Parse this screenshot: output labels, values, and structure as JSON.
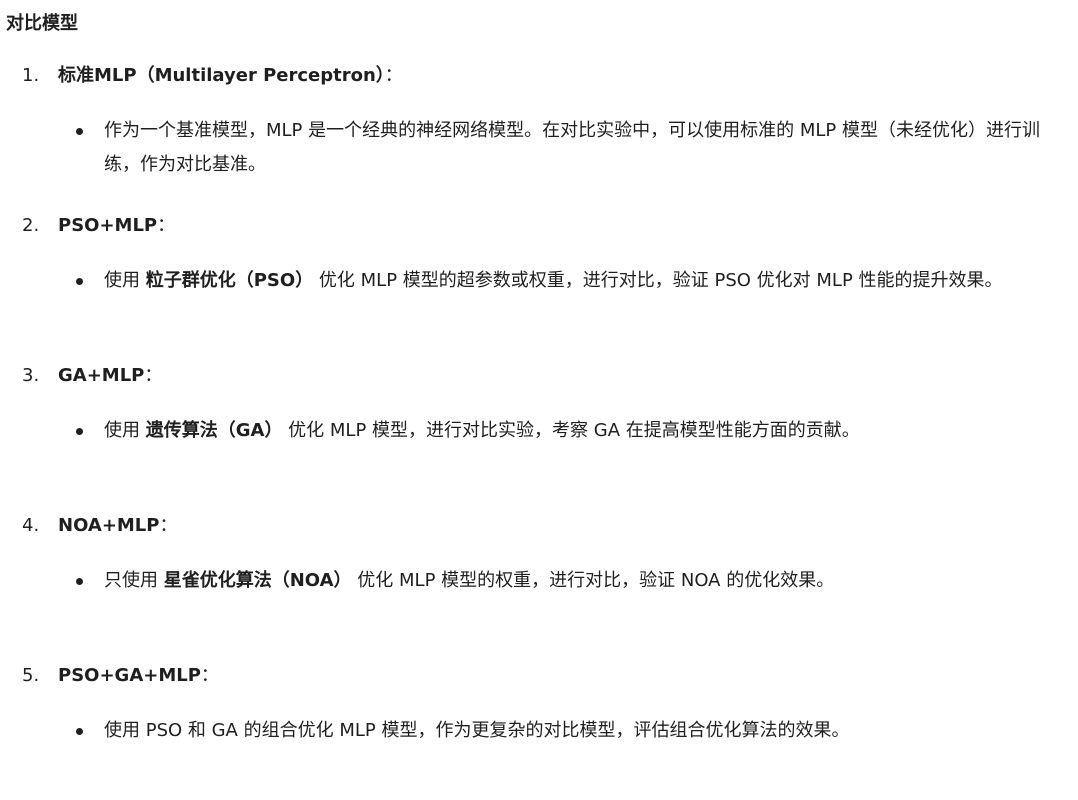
{
  "heading": "对比模型",
  "items": [
    {
      "number": "1.",
      "title": "标准MLP（Multilayer Perceptron）",
      "colon": "：",
      "bullet": {
        "pre": "作为一个基准模型，MLP 是一个经典的神经网络模型。在对比实验中，可以使用标准的 MLP 模型（未经优化）进行训练，作为对比基准。",
        "bold": "",
        "post": ""
      }
    },
    {
      "number": "2.",
      "title": "PSO+MLP",
      "colon": "：",
      "bullet": {
        "pre": "使用 ",
        "bold": "粒子群优化（PSO）",
        "post": " 优化 MLP 模型的超参数或权重，进行对比，验证 PSO 优化对 MLP 性能的提升效果。"
      }
    },
    {
      "number": "3.",
      "title": "GA+MLP",
      "colon": "：",
      "bullet": {
        "pre": "使用 ",
        "bold": "遗传算法（GA）",
        "post": " 优化 MLP 模型，进行对比实验，考察 GA 在提高模型性能方面的贡献。"
      }
    },
    {
      "number": "4.",
      "title": "NOA+MLP",
      "colon": "：",
      "bullet": {
        "pre": "只使用 ",
        "bold": "星雀优化算法（NOA）",
        "post": " 优化 MLP 模型的权重，进行对比，验证 NOA 的优化效果。"
      }
    },
    {
      "number": "5.",
      "title": "PSO+GA+MLP",
      "colon": "：",
      "bullet": {
        "pre": "使用 PSO 和 GA 的组合优化 MLP 模型，作为更复杂的对比模型，评估组合优化算法的效果。",
        "bold": "",
        "post": ""
      }
    }
  ]
}
